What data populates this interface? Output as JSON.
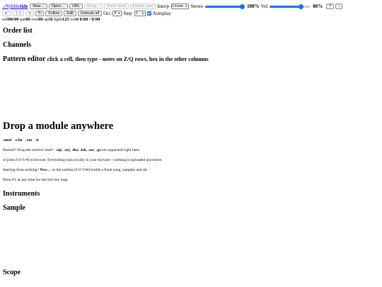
{
  "toolbar": {
    "logo_prefix": "Nybble",
    "logo_suffix": "tide",
    "buttons": {
      "new": "New…",
      "open": "Open…",
      "url": "URL",
      "song": "Song…",
      "save_mod": "Save .mod",
      "export_wav": "Export .wav",
      "help": "?",
      "collapse": "‹"
    },
    "interp_label": "Interp",
    "interp_value": "Linear",
    "stereo_label": "Stereo",
    "stereo_value": 100,
    "stereo_text": "100%",
    "vol_label": "Vol",
    "vol_value": 80,
    "vol_text": "80%",
    "transport": {
      "play": "▶",
      "pause": "❙❙",
      "stop": "■",
      "loop": "↻",
      "follow": "Follow",
      "edit": "Edit",
      "unmute_all": "Unmute all"
    },
    "oct_label": "Oct",
    "oct_value": "4",
    "step_label": "Step",
    "step_value": "1",
    "autoplay_label": "Autoplay",
    "autoplay_checked": true
  },
  "status": {
    "ord_label": "ord",
    "ord_value": "00/00",
    "pat_label": "pat",
    "pat_value": "00",
    "row_label": "row",
    "row_value": "00",
    "spd_label": "spd",
    "spd_value": "6",
    "bpm_label": "bpm",
    "bpm_value": "125",
    "voi_label": "voi",
    "voi_value": "0",
    "time_value": "0:00 / 0:00"
  },
  "sections": {
    "order_list": "Order list",
    "channels": "Channels",
    "pattern_editor": "Pattern editor",
    "pattern_editor_hint": "click a cell, then type - notes on Z/Q rows, hex in the other columns",
    "instruments": "Instruments",
    "sample": "Sample",
    "scope": "Scope"
  },
  "drop": {
    "title": "Drop a module anywhere",
    "formats": [
      ".mod",
      ".s3m",
      ".xm",
      ".it"
    ],
    "line1_pre": "Packed? Drop the archive itself - ",
    "archives": [
      ".zip",
      ".arj",
      ".lha",
      ".lzh",
      ".tar",
      ".gz"
    ],
    "line1_post": " are unpacked right here.",
    "line2_pre": "or press ",
    "line2_key": "Ctrl+O",
    "line2_post": " to browse. Everything runs locally in your browser - nothing is uploaded anywhere.",
    "line3_pre": "Starting from nothing? ",
    "line3_bold": "New…",
    "line3_mid": " in the toolbar (",
    "line3_key": "Ctrl+N",
    "line3_post": ") builds a fresh song, samples and all.",
    "line4_pre": "Press ",
    "line4_key": "F1",
    "line4_post": " at any time for the full key map."
  },
  "icons": {
    "logo": "music-note-icon"
  },
  "colors": {
    "accent": "#1a73e8",
    "link": "#0000ee"
  }
}
